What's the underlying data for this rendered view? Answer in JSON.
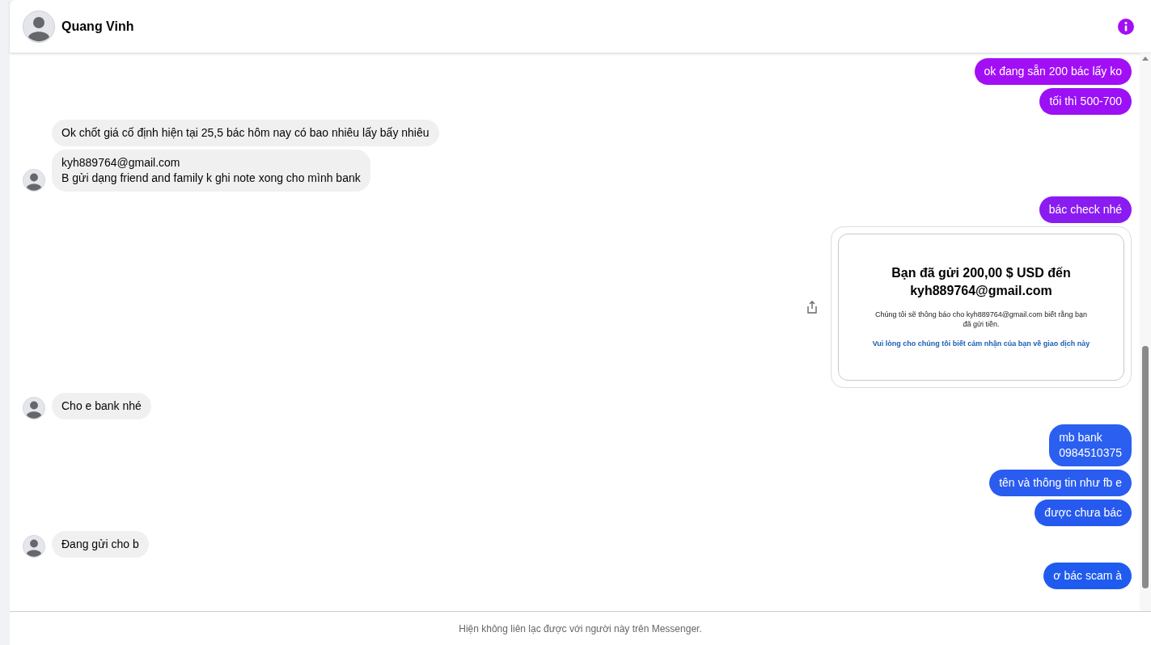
{
  "header": {
    "name": "Quang Vinh"
  },
  "groups": [
    {
      "kind": "sent",
      "messages": [
        {
          "kind": "text",
          "text": "ok đang sẵn 200 bác lấy ko",
          "color": "#a20ff5"
        },
        {
          "kind": "text",
          "text": "tối thì 500-700",
          "color": "#9b10f5"
        }
      ]
    },
    {
      "kind": "received",
      "messages": [
        {
          "kind": "text",
          "text": "Ok chốt giá cố định hiện tại 25,5 bác hôm nay có bao nhiêu lấy bấy nhiêu"
        },
        {
          "kind": "text",
          "text": "kyh889764@gmail.com\nB gửi dạng friend and family k ghi note xong cho mình bank"
        }
      ]
    },
    {
      "kind": "sent",
      "messages": [
        {
          "kind": "text",
          "text": "bác check nhé",
          "color": "#8a1cf2"
        },
        {
          "kind": "image",
          "title": "Bạn đã gửi 200,00 $ USD đến kyh889764@gmail.com",
          "body": "Chúng tôi sẽ thông báo cho kyh889764@gmail.com biết rằng bạn đã gửi tiền.",
          "link": "Vui lòng cho chúng tôi biết cảm nhận của bạn về giao dịch này"
        }
      ]
    },
    {
      "kind": "received",
      "messages": [
        {
          "kind": "text",
          "text": "Cho e bank nhé"
        }
      ]
    },
    {
      "kind": "sent",
      "messages": [
        {
          "kind": "text",
          "text": "mb bank\n0984510375",
          "color": "#2b5ff0"
        },
        {
          "kind": "text",
          "text": "tên và thông tin như fb e",
          "color": "#2a5cf0"
        },
        {
          "kind": "text",
          "text": "được chưa bác",
          "color": "#2659ee"
        }
      ]
    },
    {
      "kind": "received",
      "messages": [
        {
          "kind": "text",
          "text": "Đang gửi cho b"
        }
      ]
    },
    {
      "kind": "sent",
      "messages": [
        {
          "kind": "text",
          "text": "ơ bác scam à",
          "color": "#1f5bee"
        }
      ]
    }
  ],
  "footer": "Hiện không liên lạc được với người này trên Messenger."
}
